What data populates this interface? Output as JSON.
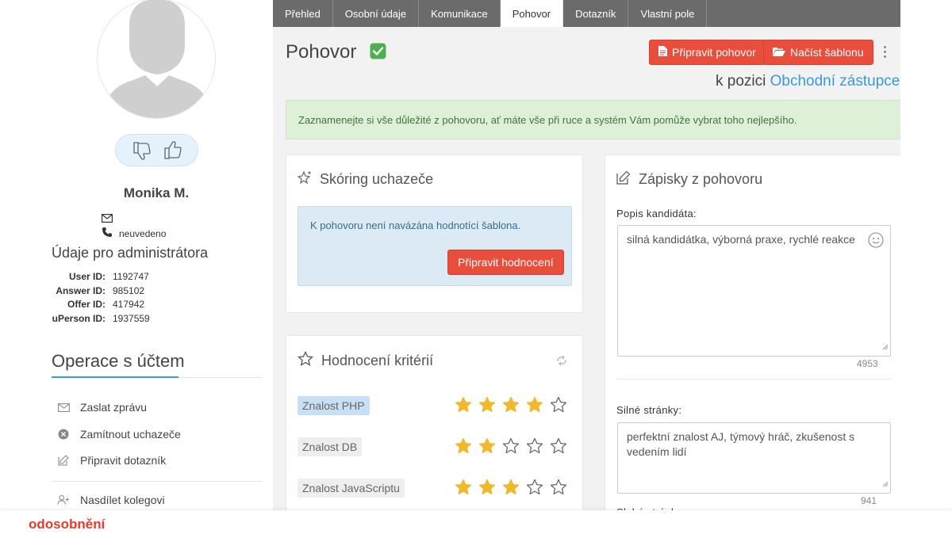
{
  "sidebar": {
    "name": "Monika M.",
    "phone": "neuvedeno",
    "admin_title": "Údaje pro administrátora",
    "ids": [
      {
        "label": "User ID:",
        "value": "1192747"
      },
      {
        "label": "Answer ID:",
        "value": "985102"
      },
      {
        "label": "Offer ID:",
        "value": "417942"
      },
      {
        "label": "uPerson ID:",
        "value": "1937559"
      }
    ],
    "ops_title": "Operace s účtem",
    "ops": [
      {
        "label": "Zaslat zprávu",
        "icon": "envelope-icon"
      },
      {
        "label": "Zamítnout uchazeče",
        "icon": "reject-icon"
      },
      {
        "label": "Připravit dotazník",
        "icon": "edit-icon"
      },
      {
        "label": "Nasdílet kolegovi",
        "icon": "add-user-icon"
      }
    ]
  },
  "tabs": [
    {
      "label": "Přehled",
      "active": false
    },
    {
      "label": "Osobní údaje",
      "active": false
    },
    {
      "label": "Komunikace",
      "active": false
    },
    {
      "label": "Pohovor",
      "active": true
    },
    {
      "label": "Dotazník",
      "active": false
    },
    {
      "label": "Vlastní pole",
      "active": false
    }
  ],
  "main": {
    "title": "Pohovor",
    "btn_prepare": "Připravit pohovor",
    "btn_load": "Načíst šablonu",
    "position_prefix": "k pozici",
    "position_name": "Obchodní zástupce",
    "banner": "Zaznamenejte si vše důležité z pohovoru, ať máte vše při ruce a systém Vám pomůže vybrat toho nejlepšího."
  },
  "scoring": {
    "title": "Skóring uchazeče",
    "notice": "K pohovoru není navázána hodnotící šablona.",
    "button": "Připravit hodnocení"
  },
  "criteria": {
    "title": "Hodnocení kritérií",
    "items": [
      {
        "label": "Znalost PHP",
        "rating": 4,
        "selected": true
      },
      {
        "label": "Znalost DB",
        "rating": 2,
        "selected": false
      },
      {
        "label": "Znalost JavaScriptu",
        "rating": 3,
        "selected": false
      }
    ]
  },
  "notes": {
    "title": "Zápisky z pohovoru",
    "desc_label": "Popis kandidáta:",
    "desc_value": "silná kandidátka, výborná praxe, rychlé reakce",
    "desc_counter": "4953",
    "strengths_label": "Silné stránky:",
    "strengths_value": "perfektní znalost AJ, týmový hráč, zkušenost s vedením lidí",
    "strengths_counter": "941",
    "weak_label": "Slabé stránky:"
  },
  "footer": {
    "label": "odosobnění"
  },
  "colors": {
    "accent_blue": "#3a9ad9",
    "button_red": "#e94e3c",
    "star_gold": "#f0b82a",
    "tabbar_gray": "#6b6b6b"
  }
}
